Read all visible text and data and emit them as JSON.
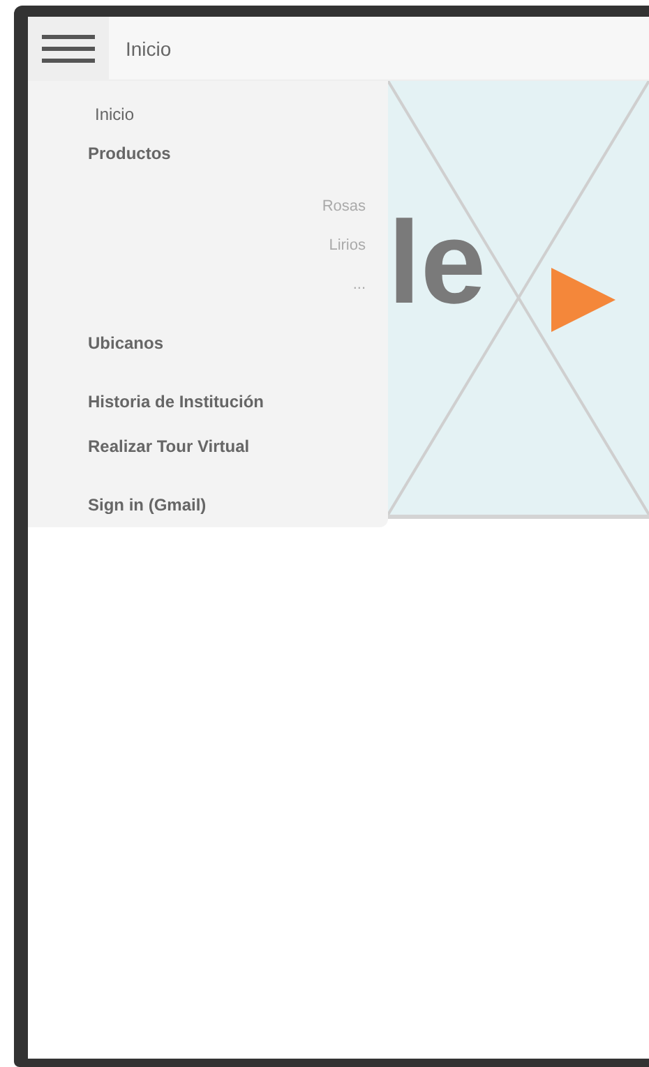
{
  "header": {
    "title": "Inicio"
  },
  "video": {
    "caption": "le"
  },
  "menu": {
    "items": [
      {
        "label": "Inicio"
      },
      {
        "label": "Productos",
        "children": [
          {
            "label": "Rosas"
          },
          {
            "label": "Lirios"
          },
          {
            "label": "..."
          }
        ]
      },
      {
        "label": "Ubicanos"
      },
      {
        "label": "Historia de Institución"
      },
      {
        "label": "Realizar Tour Virtual"
      },
      {
        "label": "Sign in (Gmail)"
      }
    ]
  }
}
